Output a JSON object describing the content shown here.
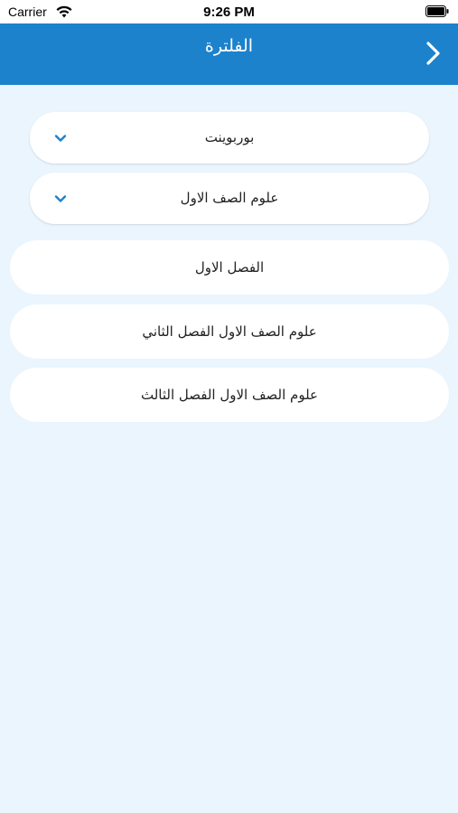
{
  "status_bar": {
    "carrier": "Carrier",
    "time": "9:26 PM"
  },
  "header": {
    "title": "الفلترة"
  },
  "filters": [
    {
      "label": "بوربوينت"
    },
    {
      "label": "علوم الصف الاول"
    }
  ],
  "items": [
    {
      "label": "الفصل الاول"
    },
    {
      "label": "علوم الصف الاول الفصل الثاني"
    },
    {
      "label": "علوم الصف الاول الفصل الثالث"
    }
  ],
  "colors": {
    "header": "#1d82cc",
    "background": "#eaf5fe",
    "accent": "#1d82cc"
  },
  "icons": [
    "wifi-icon",
    "battery-icon",
    "chevron-right-icon",
    "chevron-down-icon"
  ]
}
